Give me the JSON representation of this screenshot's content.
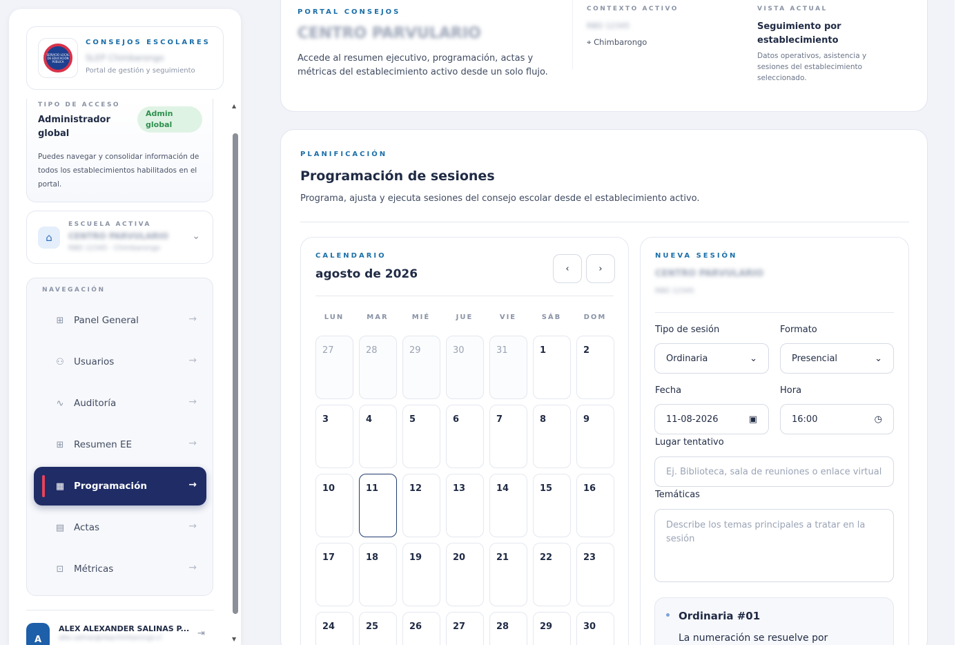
{
  "brand": {
    "kicker": "CONSEJOS ESCOLARES",
    "name": "SLEP Chimbarongo",
    "subtitle": "Portal de gestión y seguimiento",
    "logo_text": "SERVICIO LOCAL DE EDUCACIÓN PÚBLICA"
  },
  "access": {
    "kicker": "TIPO DE ACCESO",
    "role": "Administrador global",
    "badge": "Admin global",
    "description": "Puedes navegar y consolidar información de todos los establecimientos habilitados en el portal."
  },
  "school": {
    "kicker": "ESCUELA ACTIVA",
    "name": "CENTRO PARVULARIO",
    "sub": "RBD 12345 · Chimbarongo"
  },
  "nav": {
    "kicker": "NAVEGACIÓN",
    "items": [
      {
        "label": "Panel General",
        "icon": "grid-icon"
      },
      {
        "label": "Usuarios",
        "icon": "users-icon"
      },
      {
        "label": "Auditoría",
        "icon": "activity-icon"
      },
      {
        "label": "Resumen EE",
        "icon": "grid-icon"
      },
      {
        "label": "Programación",
        "icon": "calendar-icon",
        "active": true
      },
      {
        "label": "Actas",
        "icon": "document-icon"
      },
      {
        "label": "Métricas",
        "icon": "lock-icon"
      }
    ]
  },
  "user": {
    "initial": "A",
    "name": "ALEX ALEXANDER SALINAS P...",
    "email": "alex.salinas@slepchimbarongo.cl"
  },
  "hero": {
    "kicker": "PORTAL CONSEJOS",
    "title": "CENTRO PARVULARIO",
    "description": "Accede al resumen ejecutivo, programación, actas y métricas del establecimiento activo desde un solo flujo.",
    "context_kicker": "CONTEXTO ACTIVO",
    "context_code": "RBD 12345",
    "context_location": "Chimbarongo",
    "view_kicker": "VISTA ACTUAL",
    "view_title": "Seguimiento por establecimiento",
    "view_description": "Datos operativos, asistencia y sesiones del establecimiento seleccionado."
  },
  "plan": {
    "kicker": "PLANIFICACIÓN",
    "title": "Programación de sesiones",
    "description": "Programa, ajusta y ejecuta sesiones del consejo escolar desde el establecimiento activo."
  },
  "calendar": {
    "kicker": "CALENDARIO",
    "month": "agosto de 2026",
    "prev": "‹",
    "next": "›",
    "weekdays": [
      "LUN",
      "MAR",
      "MIÉ",
      "JUE",
      "VIE",
      "SÁB",
      "DOM"
    ],
    "days": [
      {
        "n": "27",
        "muted": true
      },
      {
        "n": "28",
        "muted": true
      },
      {
        "n": "29",
        "muted": true
      },
      {
        "n": "30",
        "muted": true
      },
      {
        "n": "31",
        "muted": true
      },
      {
        "n": "1"
      },
      {
        "n": "2"
      },
      {
        "n": "3"
      },
      {
        "n": "4"
      },
      {
        "n": "5"
      },
      {
        "n": "6"
      },
      {
        "n": "7"
      },
      {
        "n": "8"
      },
      {
        "n": "9"
      },
      {
        "n": "10"
      },
      {
        "n": "11",
        "today": true
      },
      {
        "n": "12"
      },
      {
        "n": "13"
      },
      {
        "n": "14"
      },
      {
        "n": "15"
      },
      {
        "n": "16"
      },
      {
        "n": "17"
      },
      {
        "n": "18"
      },
      {
        "n": "19"
      },
      {
        "n": "20"
      },
      {
        "n": "21"
      },
      {
        "n": "22"
      },
      {
        "n": "23"
      },
      {
        "n": "24"
      },
      {
        "n": "25"
      },
      {
        "n": "26"
      },
      {
        "n": "27"
      },
      {
        "n": "28"
      },
      {
        "n": "29"
      },
      {
        "n": "30"
      }
    ]
  },
  "new_session": {
    "kicker": "NUEVA SESIÓN",
    "school": "CENTRO PARVULARIO",
    "code": "RBD 12345",
    "type_label": "Tipo de sesión",
    "type_value": "Ordinaria",
    "format_label": "Formato",
    "format_value": "Presencial",
    "date_label": "Fecha",
    "date_value": "11-08-2026",
    "time_label": "Hora",
    "time_value": "16:00",
    "place_label": "Lugar tentativo",
    "place_placeholder": "Ej. Biblioteca, sala de reuniones o enlace virtual",
    "topics_label": "Temáticas",
    "topics_placeholder": "Describe los temas principales a tratar en la sesión",
    "seq_title": "Ordinaria #01",
    "seq_desc": "La numeración se resuelve por"
  },
  "colors": {
    "accent": "#1b6fa8",
    "nav_active": "#1f2c66",
    "active_marker": "#e8435a",
    "badge_bg": "#dff3e4"
  }
}
